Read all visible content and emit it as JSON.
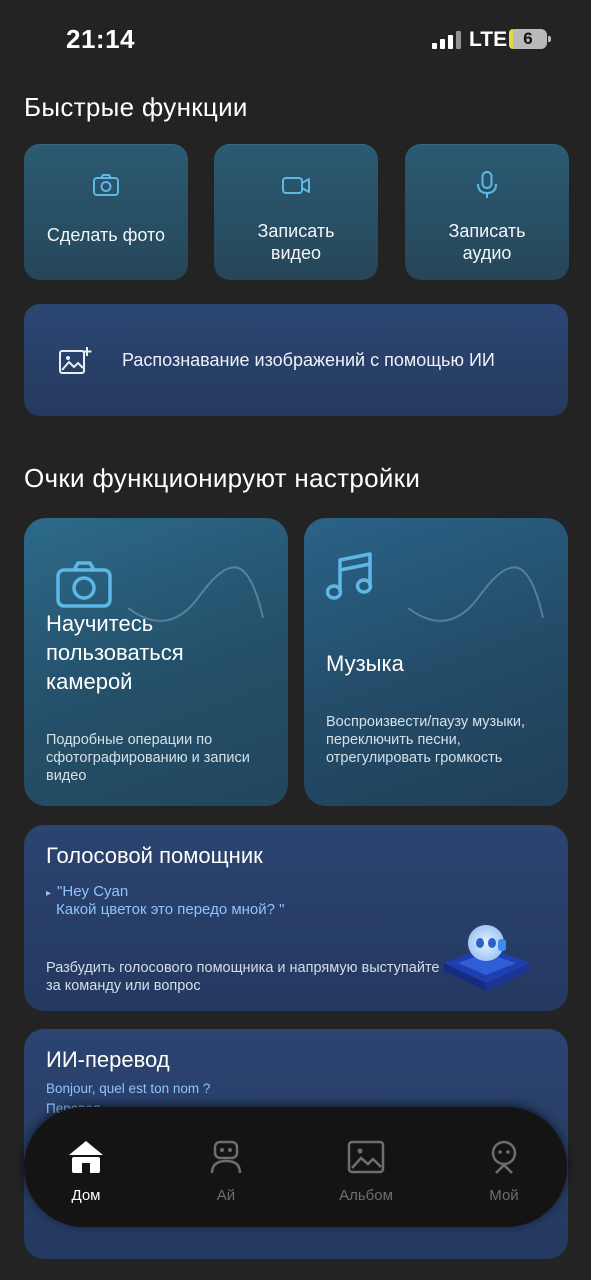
{
  "status_bar": {
    "time": "21:14",
    "network": "LTE",
    "battery": "6"
  },
  "quick_functions": {
    "title": "Быстрые функции",
    "items": [
      {
        "label": "Сделать фото",
        "icon": "camera-icon"
      },
      {
        "label": "Записать\nвидео",
        "icon": "video-camera-icon"
      },
      {
        "label": "Записать\nаудио",
        "icon": "microphone-icon"
      }
    ],
    "ai_recognition": {
      "label": "Распознавание изображений с помощью ИИ",
      "icon": "image-add-icon"
    }
  },
  "glasses_settings": {
    "title": "Очки функционируют настройки",
    "camera_card": {
      "title": "Научитесь\nпользоваться\nкамерой",
      "description": "Подробные операции по сфотографированию и записи видео",
      "icon": "camera-icon"
    },
    "music_card": {
      "title": "Музыка",
      "description": "Воспроизвести/паузу музыки, переключить песни, отрегулировать громкость",
      "icon": "music-note-icon"
    },
    "voice_assistant": {
      "title": "Голосовой помощник",
      "quote_line1": "\"Hey Cyan",
      "quote_line2": "Какой цветок это передо мной? \"",
      "description": "Разбудить голосового помощника и напрямую выступайте за команду или вопрос",
      "icon": "robot-assistant-icon"
    },
    "ai_translation": {
      "title": "ИИ-перевод",
      "line1": "Bonjour, quel est ton nom ?",
      "line2": "Перевод..."
    }
  },
  "tab_bar": {
    "active": "Дом",
    "tabs": [
      {
        "label": "Дом",
        "icon": "home-icon"
      },
      {
        "label": "Ай",
        "icon": "robot-icon"
      },
      {
        "label": "Альбом",
        "icon": "album-icon"
      },
      {
        "label": "Мой",
        "icon": "profile-icon"
      }
    ]
  },
  "colors": {
    "background": "#232323",
    "accent_text": "#8fc3ff",
    "icon_cyan": "#5fb7e6"
  }
}
